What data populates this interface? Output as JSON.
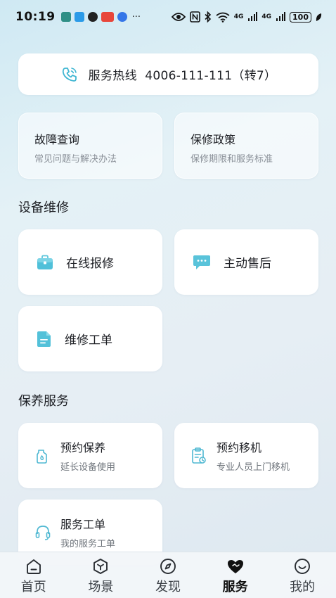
{
  "status": {
    "time": "10:19",
    "more": "···",
    "battery": "100",
    "net1": "4G",
    "net2": "4G"
  },
  "hotline": {
    "text": "服务热线  4006-111-111（转7）"
  },
  "faq": {
    "title": "故障查询",
    "subtitle": "常见问题与解决办法"
  },
  "policy": {
    "title": "保修政策",
    "subtitle": "保修期限和服务标准"
  },
  "repair": {
    "section_title": "设备维修",
    "online": "在线报修",
    "proactive": "主动售后",
    "orders": "维修工单"
  },
  "maintenance": {
    "section_title": "保养服务",
    "booking": {
      "title": "预约保养",
      "subtitle": "延长设备使用"
    },
    "relocate": {
      "title": "预约移机",
      "subtitle": "专业人员上门移机"
    },
    "service_order": {
      "title": "服务工单",
      "subtitle": "我的服务工单"
    }
  },
  "tabs": [
    {
      "label": "首页"
    },
    {
      "label": "场景"
    },
    {
      "label": "发现"
    },
    {
      "label": "服务"
    },
    {
      "label": "我的"
    }
  ],
  "colors": {
    "accent": "#3fb6d2",
    "tab_active": "#111111"
  }
}
